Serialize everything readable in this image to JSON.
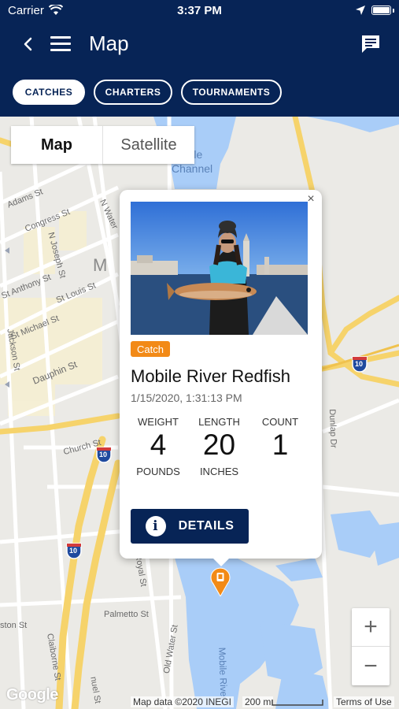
{
  "status_bar": {
    "carrier": "Carrier",
    "time": "3:37 PM"
  },
  "nav": {
    "title": "Map"
  },
  "tabs": [
    {
      "label": "CATCHES",
      "active": true
    },
    {
      "label": "CHARTERS",
      "active": false
    },
    {
      "label": "TOURNAMENTS",
      "active": false
    }
  ],
  "map": {
    "type_toggle": {
      "map": "Map",
      "satellite": "Satellite"
    },
    "zoom": {
      "in": "+",
      "out": "−"
    },
    "labels": {
      "mobile_channel_1": "Mobile",
      "mobile_channel_2": "Channel",
      "adams": "Adams St",
      "congress": "Congress St",
      "joseph": "N Joseph St",
      "anthony": "St Anthony St",
      "louis": "St Louis St",
      "michael": "St Michael St",
      "jackson": "Jackson St",
      "dauphin": "Dauphin St",
      "church": "Church St",
      "water": "N Water",
      "dunlap": "Dunlap Dr",
      "royal": "Royal St",
      "palmetto": "Palmetto St",
      "old_water": "Old Water St",
      "claiborne": "Claiborne St",
      "mobile_river": "Mobile River",
      "city_fragment": "M",
      "ston": "ston St",
      "nuel": "nuel St"
    },
    "highway_shields": [
      "10",
      "10",
      "10"
    ],
    "google": "Google",
    "attribution": {
      "data": "Map data ©2020 INEGI",
      "scale": "200 m",
      "terms": "Terms of Use"
    }
  },
  "catch_card": {
    "badge": "Catch",
    "title": "Mobile River Redfish",
    "date": "1/15/2020, 1:31:13 PM",
    "stats": [
      {
        "label": "WEIGHT",
        "value": "4",
        "unit": "POUNDS"
      },
      {
        "label": "LENGTH",
        "value": "20",
        "unit": "INCHES"
      },
      {
        "label": "COUNT",
        "value": "1",
        "unit": ""
      }
    ],
    "details_label": "DETAILS",
    "close": "×"
  },
  "colors": {
    "header": "#072456",
    "badge": "#f28a17",
    "water": "#a9cdf8",
    "highway": "#f6d36b",
    "marker": "#f28a17"
  }
}
